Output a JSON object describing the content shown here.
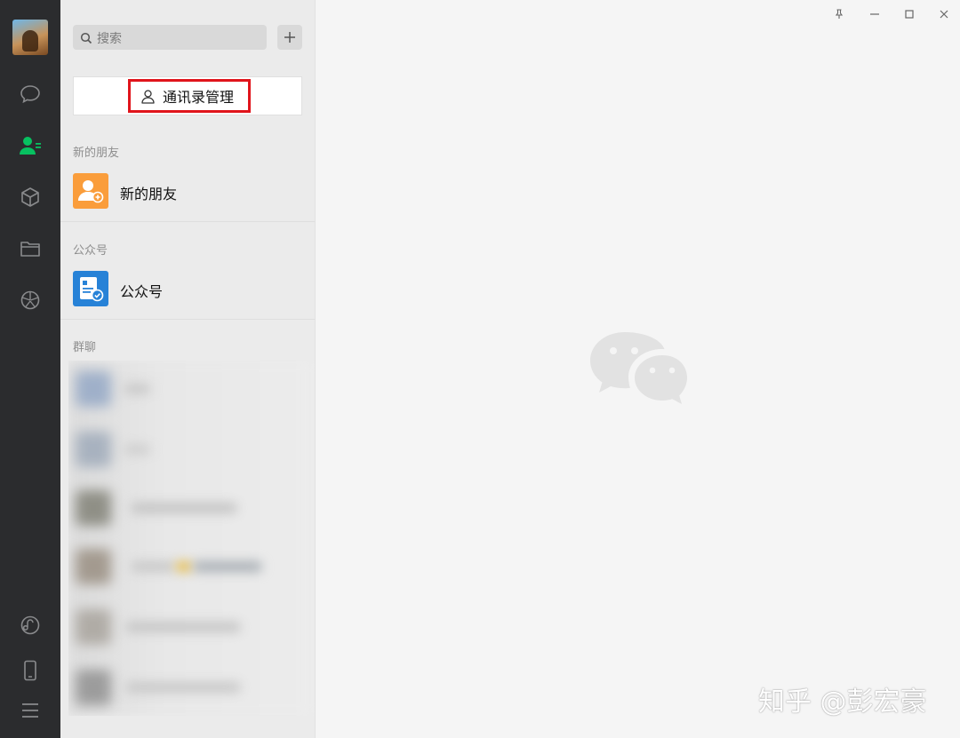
{
  "sidebar": {
    "avatar": "user-avatar",
    "nav": [
      {
        "icon": "chat-bubble-icon"
      },
      {
        "icon": "contacts-icon",
        "active": true
      },
      {
        "icon": "cube-icon"
      },
      {
        "icon": "folder-icon"
      },
      {
        "icon": "moments-icon"
      },
      {
        "icon": "mini-program-icon"
      },
      {
        "icon": "phone-icon"
      },
      {
        "icon": "menu-icon"
      }
    ],
    "active_color": "#07c160"
  },
  "contacts": {
    "search": {
      "placeholder": "搜索"
    },
    "manage_button": {
      "label": "通讯录管理"
    },
    "sections": [
      {
        "title": "新的朋友",
        "items": [
          {
            "label": "新的朋友",
            "icon": "new-friend-icon",
            "color": "#fa9d3b"
          }
        ]
      },
      {
        "title": "公众号",
        "items": [
          {
            "label": "公众号",
            "icon": "official-account-icon",
            "color": "#2782d7"
          }
        ]
      },
      {
        "title": "群聊",
        "items": []
      }
    ]
  },
  "main": {
    "logo": "wechat-logo-icon"
  },
  "watermark": "知乎 @彭宏豪",
  "highlight_color": "#e0141b"
}
